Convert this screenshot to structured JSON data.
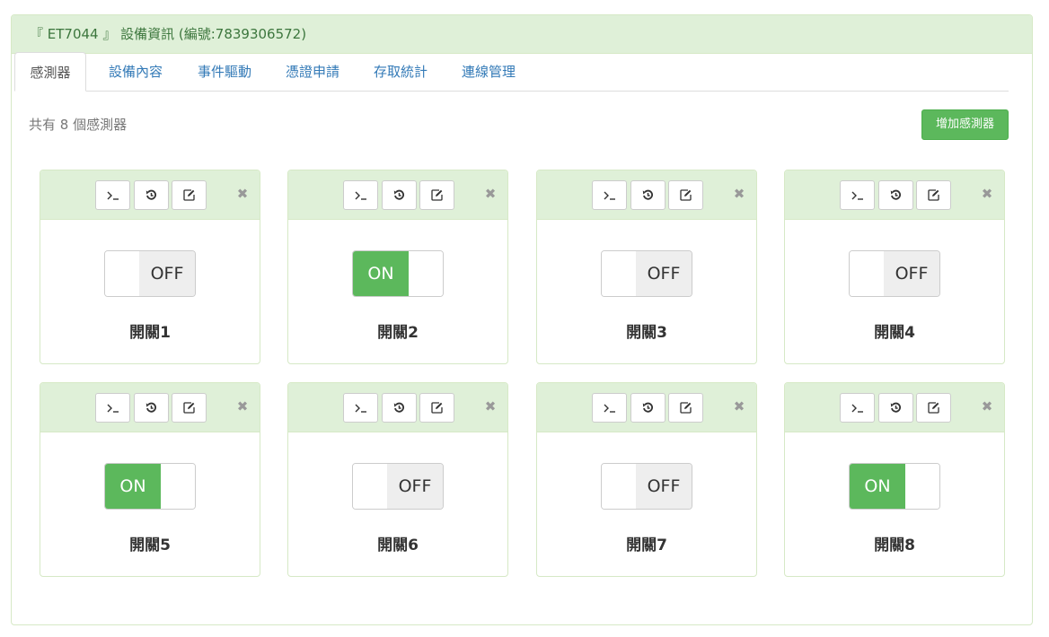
{
  "header": {
    "title": "『 ET7044 』 設備資訊 (編號:7839306572)"
  },
  "tabs": [
    {
      "label": "感測器",
      "active": true
    },
    {
      "label": "設備內容",
      "active": false
    },
    {
      "label": "事件驅動",
      "active": false
    },
    {
      "label": "憑證申請",
      "active": false
    },
    {
      "label": "存取統計",
      "active": false
    },
    {
      "label": "連線管理",
      "active": false
    }
  ],
  "summary": {
    "count_text": "共有 8 個感測器"
  },
  "add_button": {
    "label": "增加感測器"
  },
  "colors": {
    "accent": "#5cb85c",
    "header_bg": "#dff0d8",
    "header_text": "#3c763d",
    "link": "#337ab7"
  },
  "toolbar_icons": [
    "terminal-icon",
    "history-icon",
    "edit-icon",
    "close-icon"
  ],
  "sensors": [
    {
      "name": "開關1",
      "state": "OFF"
    },
    {
      "name": "開關2",
      "state": "ON"
    },
    {
      "name": "開關3",
      "state": "OFF"
    },
    {
      "name": "開關4",
      "state": "OFF"
    },
    {
      "name": "開關5",
      "state": "ON"
    },
    {
      "name": "開關6",
      "state": "OFF"
    },
    {
      "name": "開關7",
      "state": "OFF"
    },
    {
      "name": "開關8",
      "state": "ON"
    }
  ]
}
